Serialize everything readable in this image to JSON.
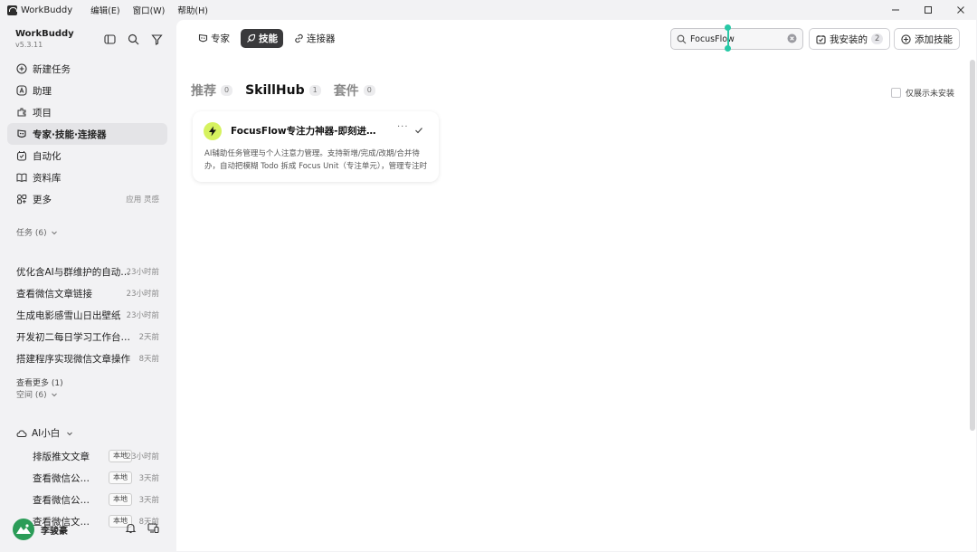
{
  "app": {
    "name": "WorkBuddy",
    "version": "v5.3.11"
  },
  "menu": [
    "编辑(E)",
    "窗口(W)",
    "帮助(H)"
  ],
  "sidebar": {
    "nav": [
      {
        "label": "新建任务",
        "icon": "plus-circle-icon"
      },
      {
        "label": "助理",
        "icon": "assistant-icon"
      },
      {
        "label": "项目",
        "icon": "project-icon"
      },
      {
        "label": "专家·技能·连接器",
        "icon": "expert-icon",
        "active": true
      },
      {
        "label": "自动化",
        "icon": "automation-icon"
      },
      {
        "label": "资料库",
        "icon": "book-icon"
      },
      {
        "label": "更多",
        "icon": "grid-icon",
        "extra": "应用 灵感"
      }
    ],
    "tasks_header": "任务 (6)",
    "tasks": [
      {
        "name": "优化含AI与群维护的自动化任务",
        "time": "23小时前"
      },
      {
        "name": "查看微信文章链接",
        "time": "23小时前"
      },
      {
        "name": "生成电影感雪山日出壁纸",
        "time": "23小时前"
      },
      {
        "name": "开发初二每日学习工作台网站",
        "time": "2天前"
      },
      {
        "name": "搭建程序实现微信文章操作",
        "time": "8天前"
      }
    ],
    "see_more": "查看更多 (1)",
    "spaces_header": "空间 (6)",
    "space_root": "AI小白",
    "spaces": [
      {
        "name": "排版推文文章",
        "tag": "本地",
        "time": "23小时前"
      },
      {
        "name": "查看微信公众号文章",
        "tag": "本地",
        "time": "3天前"
      },
      {
        "name": "查看微信公众号链接",
        "tag": "本地",
        "time": "3天前"
      },
      {
        "name": "查看微信文章内容",
        "tag": "本地",
        "time": "8天前"
      }
    ],
    "user": {
      "name": "李骏豪"
    }
  },
  "top_tabs": [
    {
      "label": "专家",
      "icon": "expert-icon"
    },
    {
      "label": "技能",
      "icon": "skill-icon",
      "active": true
    },
    {
      "label": "连接器",
      "icon": "link-icon"
    }
  ],
  "search": {
    "value": "FocusFlow",
    "placeholder": "搜索"
  },
  "installed_button": {
    "label": "我安装的",
    "count": "2"
  },
  "add_skill_button": {
    "label": "添加技能"
  },
  "categories": [
    {
      "label": "推荐",
      "count": "0"
    },
    {
      "label": "SkillHub",
      "count": "1",
      "active": true
    },
    {
      "label": "套件",
      "count": "0"
    }
  ],
  "only_uninstalled": "仅展示未安装",
  "cards": [
    {
      "title": "FocusFlow专注力神器-即刻进入心流状态",
      "more": "···",
      "desc": "AI辅助任务管理与个人注意力管理。支持新增/完成/改期/合并待办，自动把模糊 Todo 拆成 Focus Unit（专注单元），管理专注时段与复盘。"
    }
  ],
  "colors": {
    "accent_green": "#27c8a6",
    "card_icon_bg": "#d6f25f",
    "active_tab": "#3a3a3c"
  }
}
